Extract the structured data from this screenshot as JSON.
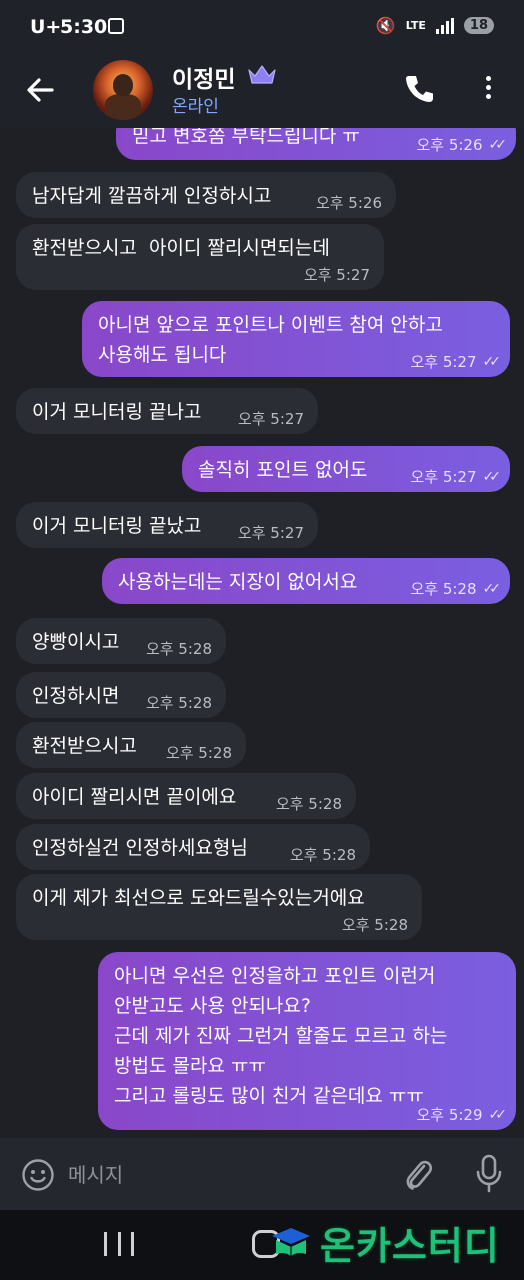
{
  "status_bar": {
    "carrier": "U+",
    "time": "5:30",
    "network": "LTE",
    "battery": "18"
  },
  "header": {
    "contact_name": "이정민",
    "contact_status": "온라인",
    "icons": [
      "back-arrow-icon",
      "crown-icon",
      "phone-icon",
      "more-vert-icon"
    ]
  },
  "messages": [
    {
      "dir": "out",
      "text": "믿고 변호쫌 부탁드립니다 ㅠ",
      "time": "오후 5:26",
      "read": true
    },
    {
      "dir": "in",
      "text": "남자답게 깔끔하게 인정하시고",
      "time": "오후 5:26"
    },
    {
      "dir": "in",
      "text": "환전받으시고  아이디 짤리시면되는데",
      "time": "오후 5:27"
    },
    {
      "dir": "out",
      "text": "아니면 앞으로 포인트나 이벤트 참여 안하고\n사용해도 됩니다",
      "time": "오후 5:27",
      "read": true
    },
    {
      "dir": "in",
      "text": "이거 모니터링 끝나고",
      "time": "오후 5:27"
    },
    {
      "dir": "out",
      "text": "솔직히 포인트 없어도",
      "time": "오후 5:27",
      "read": true
    },
    {
      "dir": "in",
      "text": "이거 모니터링 끝났고",
      "time": "오후 5:27"
    },
    {
      "dir": "out",
      "text": "사용하는데는 지장이 없어서요",
      "time": "오후 5:28",
      "read": true
    },
    {
      "dir": "in",
      "text": "양빵이시고",
      "time": "오후 5:28"
    },
    {
      "dir": "in",
      "text": "인정하시면",
      "time": "오후 5:28"
    },
    {
      "dir": "in",
      "text": "환전받으시고",
      "time": "오후 5:28"
    },
    {
      "dir": "in",
      "text": "아이디 짤리시면 끝이에요",
      "time": "오후 5:28"
    },
    {
      "dir": "in",
      "text": "인정하실건 인정하세요형님",
      "time": "오후 5:28"
    },
    {
      "dir": "in",
      "text": "이게 제가 최선으로 도와드릴수있는거에요",
      "time": "오후 5:28"
    },
    {
      "dir": "out",
      "text": "아니면 우선은 인정을하고 포인트 이런거\n안받고도 사용 안되나요?\n근데 제가 진짜 그런거 할줄도 모르고 하는\n방법도 몰라요 ㅠㅠ\n그리고 롤링도 많이 친거 같은데요 ㅠㅠ",
      "time": "오후 5:29",
      "read": true
    }
  ],
  "input": {
    "placeholder": "메시지"
  },
  "watermark": {
    "text": "온카스터디"
  },
  "colors": {
    "outgoing_bubble": "#8a47c9",
    "incoming_bubble": "#2a2d33",
    "online_status": "#7fa8ff",
    "watermark": "#1ec07a"
  }
}
